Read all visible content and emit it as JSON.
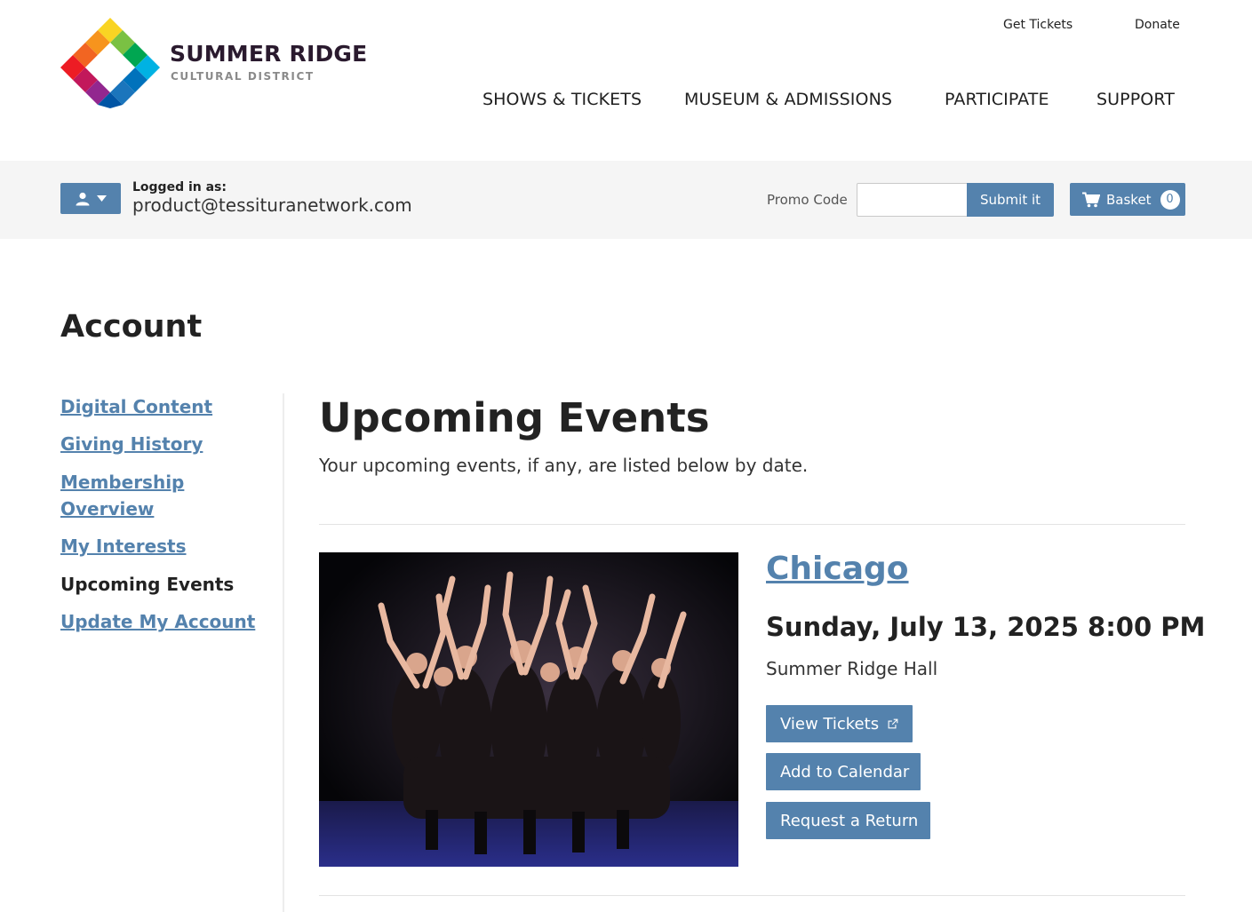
{
  "brand": {
    "name": "SUMMER RIDGE",
    "subtitle": "CULTURAL DISTRICT",
    "colors": [
      "#f9d423",
      "#7ac143",
      "#00a651",
      "#00b2e3",
      "#0055a5",
      "#92278f",
      "#ed1c24",
      "#f7941d"
    ]
  },
  "utility_nav": {
    "get_tickets": "Get Tickets",
    "donate": "Donate"
  },
  "main_nav": {
    "shows": "SHOWS & TICKETS",
    "museum": "MUSEUM & ADMISSIONS",
    "participate": "PARTICIPATE",
    "support": "SUPPORT"
  },
  "account_bar": {
    "user_icon": "user-icon",
    "logged_in_label": "Logged in as:",
    "email": "product@tessituranetwork.com",
    "promo_label": "Promo Code",
    "promo_value": "",
    "submit_label": "Submit it",
    "basket_label": "Basket",
    "basket_count": "0"
  },
  "page": {
    "title": "Account"
  },
  "sidebar": {
    "items": [
      {
        "label": "Digital Content"
      },
      {
        "label": "Giving History"
      },
      {
        "label_line1": "Membership",
        "label_line2": "Overview"
      },
      {
        "label": "My Interests"
      },
      {
        "label": "Upcoming Events"
      },
      {
        "label": "Update My Account"
      }
    ]
  },
  "main": {
    "title": "Upcoming Events",
    "description": "Your upcoming events, if any, are listed below by date.",
    "events": [
      {
        "title": "Chicago",
        "datetime": "Sunday, July 13, 2025 8:00 PM",
        "venue": "Summer Ridge Hall",
        "buttons": {
          "view_tickets": "View Tickets",
          "add_calendar": "Add to Calendar",
          "request_return": "Request a Return"
        }
      }
    ]
  },
  "accent_color": "#5482ad"
}
